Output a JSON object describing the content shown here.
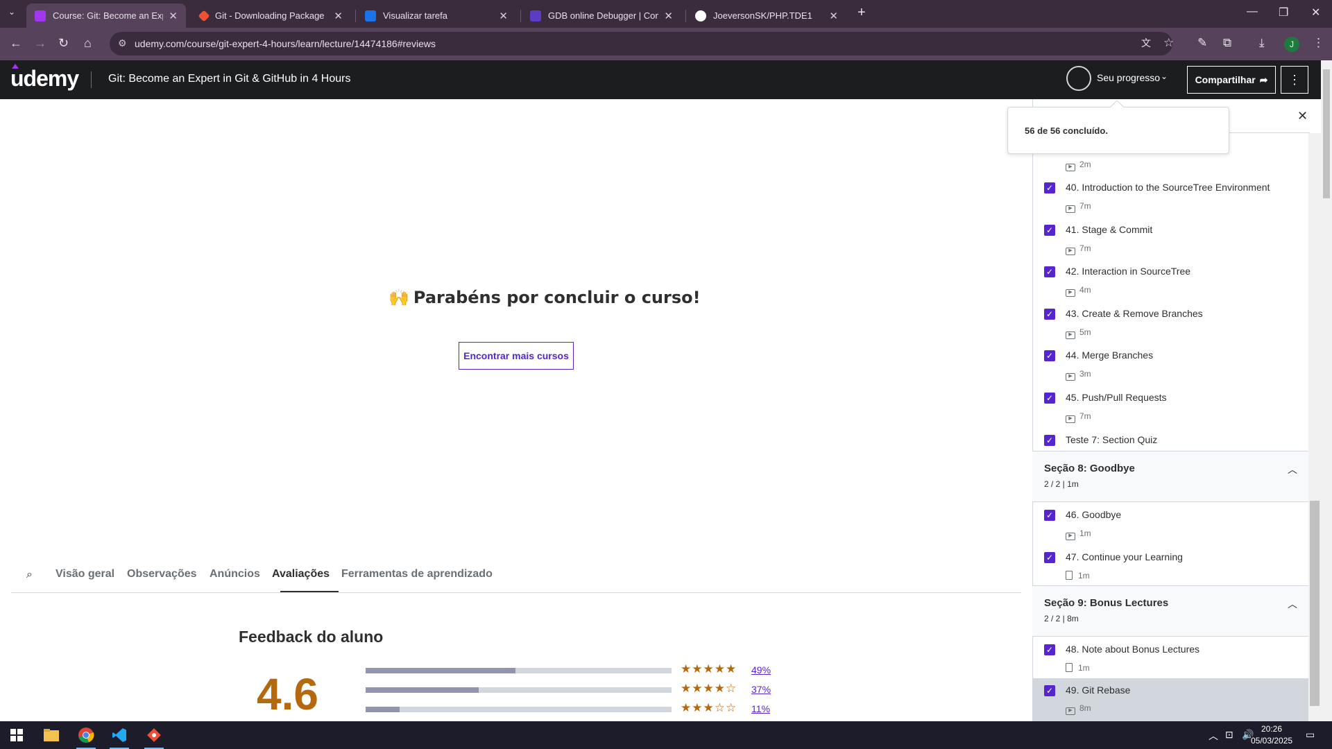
{
  "browser": {
    "tabs": [
      {
        "title": "Course: Git: Become an Expert in Git",
        "favicon_color": "#a435f0",
        "active": true
      },
      {
        "title": "Git - Downloading Package",
        "favicon_color": "#f05033"
      },
      {
        "title": "Visualizar tarefa",
        "favicon_color": "#1a73e8"
      },
      {
        "title": "GDB online Debugger | Compiler",
        "favicon_color": "#5b3cc4"
      },
      {
        "title": "JoeversonSK/PHP.TDE1",
        "favicon_color": "#ffffff"
      }
    ],
    "url": "udemy.com/course/git-expert-4-hours/learn/lecture/14474186#reviews",
    "profile_initial": "J"
  },
  "header": {
    "logo": "udemy",
    "course_title": "Git: Become an Expert in Git & GitHub in 4 Hours",
    "progress_label": "Seu progresso",
    "share_label": "Compartilhar"
  },
  "popover": {
    "text": "56 de 56 concluído."
  },
  "main": {
    "congrats": "Parabéns por concluir o curso!",
    "find_courses": "Encontrar mais cursos"
  },
  "tabs_nav": {
    "items": [
      "Visão geral",
      "Observações",
      "Anúncios",
      "Avaliações",
      "Ferramentas de aprendizado"
    ],
    "active": "Avaliações"
  },
  "feedback": {
    "title": "Feedback do aluno",
    "rating": "4.6",
    "breakdown": [
      {
        "stars": 5,
        "percent": 49,
        "label": "49%"
      },
      {
        "stars": 4,
        "percent": 37,
        "label": "37%"
      },
      {
        "stars": 3,
        "percent": 11,
        "label": "11%"
      }
    ]
  },
  "sidebar": {
    "lectures_top": [
      {
        "meta": "2m"
      },
      {
        "title": "40. Introduction to the SourceTree Environment",
        "meta": "7m"
      },
      {
        "title": "41. Stage & Commit",
        "meta": "7m"
      },
      {
        "title": "42. Interaction in SourceTree",
        "meta": "4m"
      },
      {
        "title": "43. Create & Remove Branches",
        "meta": "5m"
      },
      {
        "title": "44. Merge Branches",
        "meta": "3m"
      },
      {
        "title": "45. Push/Pull Requests",
        "meta": "7m"
      },
      {
        "title": "Teste 7: Section Quiz"
      }
    ],
    "section8": {
      "title": "Seção 8: Goodbye",
      "meta": "2 / 2 | 1m"
    },
    "section8_lectures": [
      {
        "title": "46. Goodbye",
        "meta": "1m"
      },
      {
        "title": "47. Continue your Learning",
        "meta": "1m"
      }
    ],
    "section9": {
      "title": "Seção 9: Bonus Lectures",
      "meta": "2 / 2 | 8m"
    },
    "section9_lectures": [
      {
        "title": "48. Note about Bonus Lectures",
        "meta": "1m"
      },
      {
        "title": "49. Git Rebase",
        "meta": "8m"
      }
    ]
  },
  "taskbar": {
    "time": "20:26",
    "date": "05/03/2025"
  }
}
